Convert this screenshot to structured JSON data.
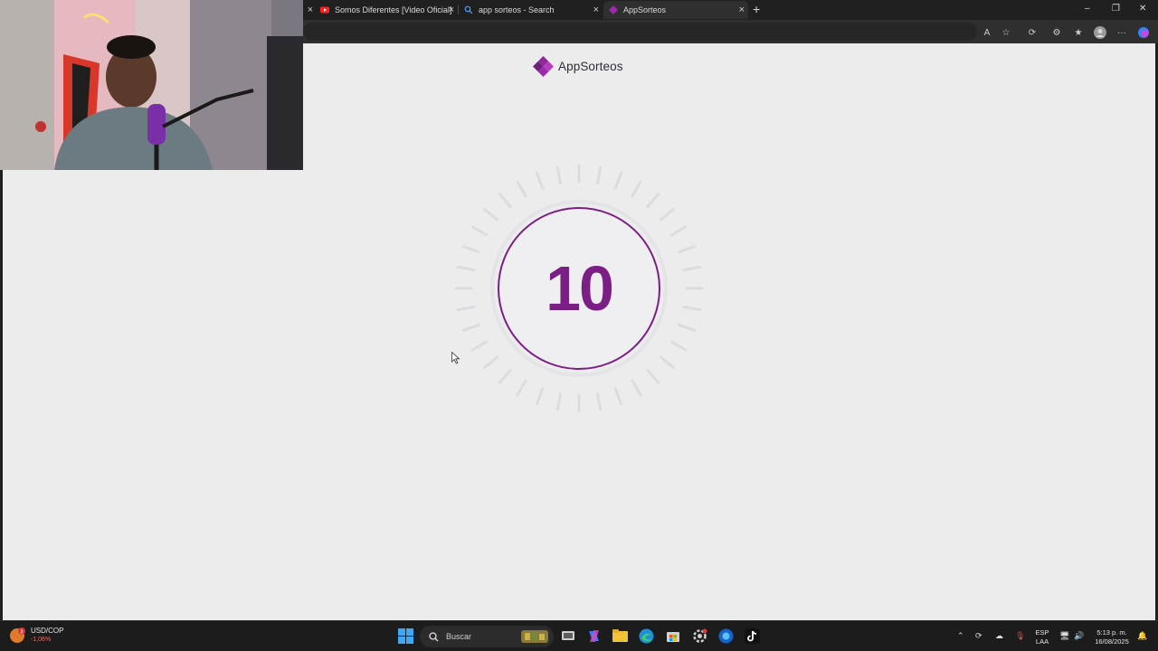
{
  "browser": {
    "tabs": [
      {
        "title": "Somos Diferentes [Video Oficial]",
        "icon": "youtube-icon",
        "active": false
      },
      {
        "title": "app sorteos - Search",
        "icon": "search-icon",
        "active": false
      },
      {
        "title": "AppSorteos",
        "icon": "appsorteos-favicon",
        "active": true
      }
    ],
    "new_tab": "+",
    "window_controls": {
      "minimize": "–",
      "restore": "❐",
      "close": "✕"
    },
    "toolbar_icons": [
      "read-aloud-icon",
      "favorite-star-icon",
      "refresh-extension-icon",
      "extensions-icon",
      "favorites-icon",
      "profile-icon",
      "more-icon",
      "copilot-icon"
    ]
  },
  "page": {
    "logo_text": "AppSorteos",
    "countdown": "10",
    "colors": {
      "accent": "#7b1f86",
      "background": "#ececed"
    }
  },
  "taskbar": {
    "widget": {
      "label": "USD/COP",
      "value": "-1,06%",
      "badge": "3"
    },
    "search_placeholder": "Buscar",
    "pinned_icons": [
      "windows-start-icon",
      "search-icon",
      "widgets-icon",
      "task-view-icon",
      "copilot-icon",
      "file-explorer-icon",
      "edge-icon",
      "store-icon",
      "settings-icon",
      "browser-icon",
      "tiktok-icon"
    ],
    "tray": {
      "language": "ESP",
      "layout": "LAA",
      "time": "5:13 p. m.",
      "date": "16/08/2025"
    }
  }
}
